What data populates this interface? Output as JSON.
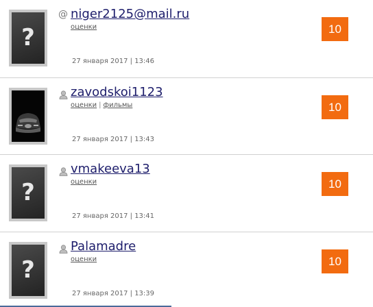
{
  "entries": [
    {
      "username": "niger2125@mail.ru",
      "icon": "at-icon",
      "links": [
        "оценки"
      ],
      "date": "27 января 2017 | 13:46",
      "score": "10",
      "avatar": "placeholder"
    },
    {
      "username": "zavodskoi1123",
      "icon": "user-icon",
      "links": [
        "оценки",
        "фильмы"
      ],
      "date": "27 января 2017 | 13:43",
      "score": "10",
      "avatar": "photo"
    },
    {
      "username": "vmakeeva13",
      "icon": "user-icon",
      "links": [
        "оценки"
      ],
      "date": "27 января 2017 | 13:41",
      "score": "10",
      "avatar": "placeholder"
    },
    {
      "username": "Palamadre",
      "icon": "user-icon",
      "links": [
        "оценки"
      ],
      "date": "27 января 2017 | 13:39",
      "score": "10",
      "avatar": "placeholder"
    }
  ],
  "placeholder_glyph": "?",
  "link_separator": "|",
  "colors": {
    "score_bg": "#f26b10",
    "username": "#1d1d6b",
    "divider": "#d0d0d0"
  }
}
